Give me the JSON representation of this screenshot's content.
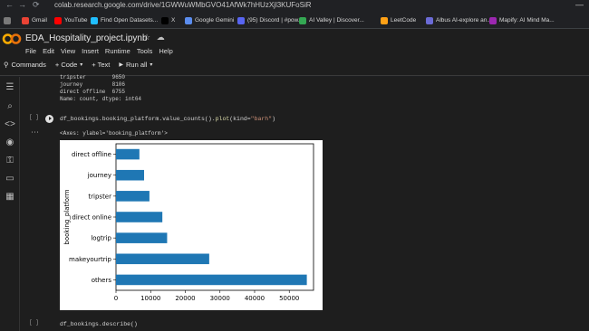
{
  "browser": {
    "back": "←",
    "forward": "→",
    "reload": "⟳",
    "url": "colab.research.google.com/drive/1GWWuWMbGVO41AfWk7hHUzXjl3KUFoSiR",
    "minimize": "—"
  },
  "bookmarks": [
    {
      "label": "",
      "color": "#7a7a7a"
    },
    {
      "label": "Gmail",
      "color": "#ea4335"
    },
    {
      "label": "YouTube",
      "color": "#ff0000"
    },
    {
      "label": "Find Open Datasets...",
      "color": "#20beff"
    },
    {
      "label": "X",
      "color": "#000000"
    },
    {
      "label": "Google Gemini",
      "color": "#5b8def"
    },
    {
      "label": "(95) Discord | #pow...",
      "color": "#5865f2"
    },
    {
      "label": "AI Valley | Discover...",
      "color": "#34a853"
    },
    {
      "label": "LeetCode",
      "color": "#ffa116"
    },
    {
      "label": "Albus AI-explore an...",
      "color": "#6b6bd6"
    },
    {
      "label": "Mapify: AI Mind Ma...",
      "color": "#9c27b0"
    }
  ],
  "notebook": {
    "title": "EDA_Hospitality_project.ipynb",
    "menu": [
      "File",
      "Edit",
      "View",
      "Insert",
      "Runtime",
      "Tools",
      "Help"
    ],
    "toolbar": {
      "commands": "Commands",
      "code": "+ Code",
      "text": "+ Text",
      "run_all": "Run all"
    }
  },
  "output_prev": [
    "tripster        9650",
    "journey         8106",
    "direct offline  6755",
    "Name: count, dtype: int64"
  ],
  "cell1": {
    "bracket": "[ ]",
    "code_obj": "df_bookings.booking_platform.value_counts().",
    "code_fn": "plot",
    "code_open": "(kind=",
    "code_str": "\"barh\"",
    "code_close": ")",
    "out_text": "<Axes: ylabel='booking_platform'>"
  },
  "cell2": {
    "bracket": "[ ]",
    "code": "df_bookings.describe()"
  },
  "chart_data": {
    "type": "bar",
    "orientation": "horizontal",
    "categories": [
      "others",
      "makeyourtrip",
      "logtrip",
      "direct online",
      "tripster",
      "journey",
      "direct offline"
    ],
    "values": [
      55066,
      26898,
      14756,
      13379,
      9650,
      8106,
      6755
    ],
    "ylabel": "booking_platform",
    "xlabel": "",
    "xlim": [
      0,
      57000
    ],
    "xticks": [
      "0",
      "10000",
      "20000",
      "30000",
      "40000",
      "50000"
    ],
    "bar_color": "#1f77b4"
  }
}
